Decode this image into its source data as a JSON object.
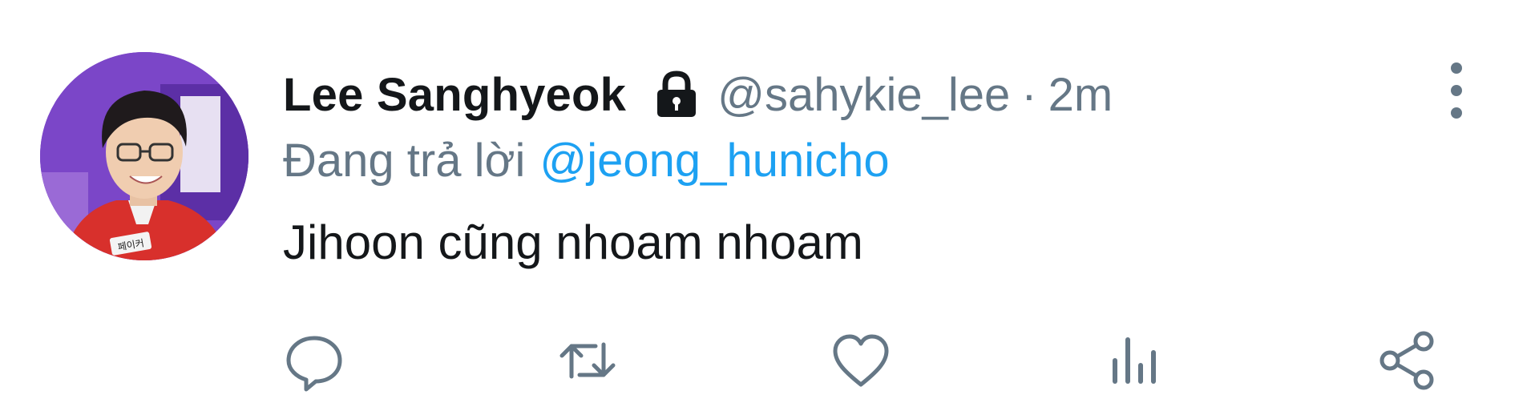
{
  "tweet": {
    "display_name": "Lee Sanghyeok",
    "protected_icon": "lock-icon",
    "handle": "@sahykie_lee",
    "separator": "·",
    "time": "2m",
    "reply_prefix": "Đang trả lời",
    "reply_to": "@jeong_hunicho",
    "text": "Jihoon cũng nhoam nhoam",
    "avatar_badge_text": "페이커"
  },
  "actions": [
    {
      "name": "reply",
      "icon": "comment-icon"
    },
    {
      "name": "retweet",
      "icon": "retweet-icon"
    },
    {
      "name": "like",
      "icon": "heart-icon"
    },
    {
      "name": "stats",
      "icon": "bar-chart-icon"
    },
    {
      "name": "share",
      "icon": "share-icon"
    }
  ],
  "colors": {
    "text": "#14171a",
    "secondary": "#657786",
    "link": "#1da1f2",
    "icon": "#657786",
    "avatar_bg": "#7a3fc9"
  }
}
